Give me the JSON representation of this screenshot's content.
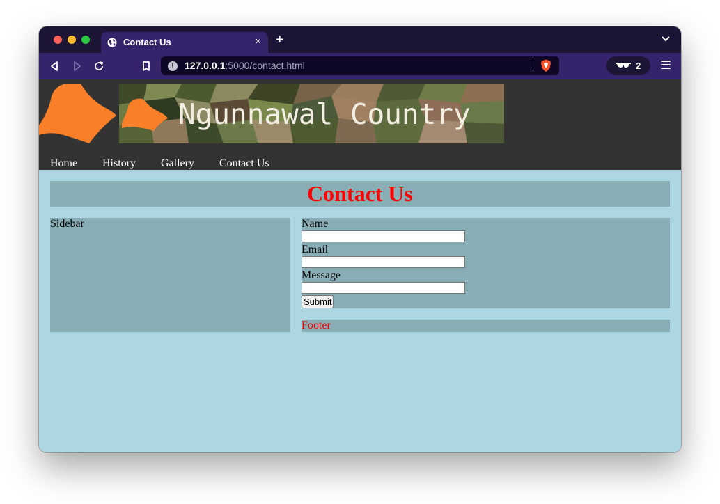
{
  "browser": {
    "tab_title": "Contact Us",
    "tab_close": "×",
    "new_tab": "+",
    "url_host": "127.0.0.1",
    "url_rest": ":5000/contact.html",
    "url_info": "!",
    "wallet_count": "2"
  },
  "site": {
    "banner_title": "Ngunnawal Country",
    "nav": [
      {
        "label": "Home"
      },
      {
        "label": "History"
      },
      {
        "label": "Gallery"
      },
      {
        "label": "Contact Us"
      }
    ],
    "page_title": "Contact Us",
    "sidebar_text": "Sidebar",
    "form": {
      "name_label": "Name",
      "name_value": "",
      "email_label": "Email",
      "email_value": "",
      "message_label": "Message",
      "message_value": "",
      "submit_label": "Submit"
    },
    "footer_text": "Footer"
  },
  "colors": {
    "page_background": "#add6e3",
    "panel_background": "#88adb5",
    "header_background": "#333333",
    "title_color": "#ff0000",
    "logo_orange": "#f98028"
  },
  "icons": [
    "globe-icon",
    "close-icon",
    "plus-icon",
    "chevron-down-icon",
    "back-icon",
    "forward-icon",
    "reload-icon",
    "bookmark-icon",
    "info-icon",
    "brave-shield-icon",
    "glasses-icon",
    "hamburger-menu-icon"
  ]
}
